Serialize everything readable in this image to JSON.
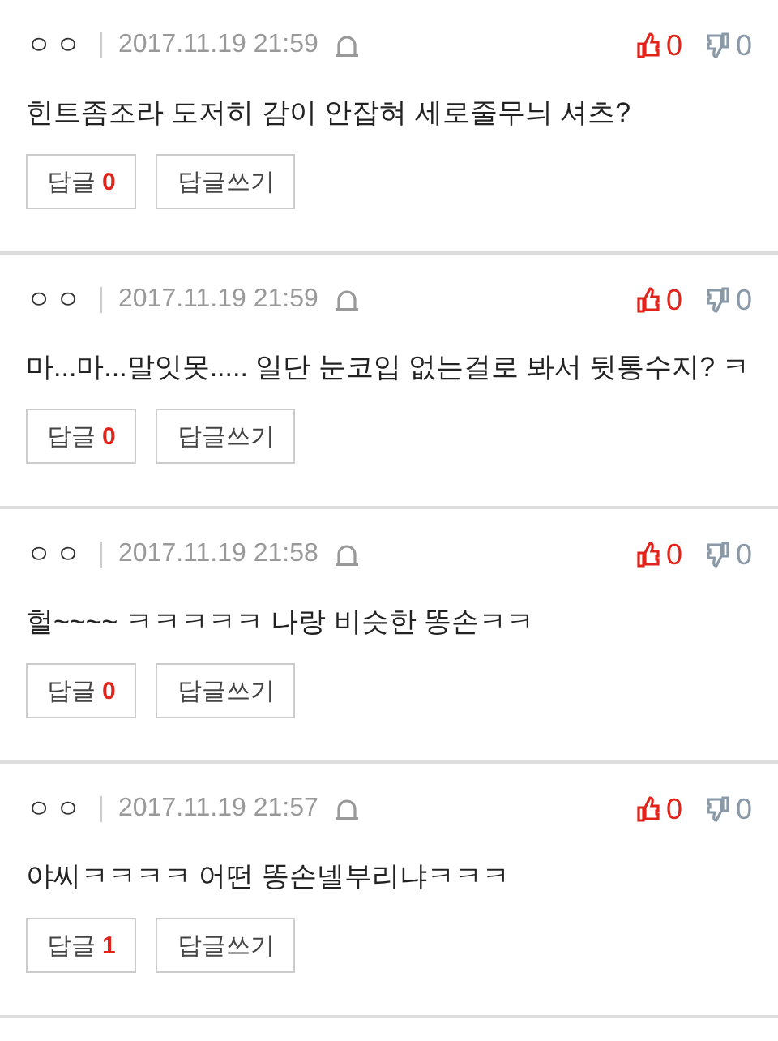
{
  "comments": [
    {
      "author": "ㅇㅇ",
      "date": "2017.11.19 21:59",
      "likes": "0",
      "dislikes": "0",
      "text": "힌트좀조라 도저히 감이 안잡혀 세로줄무늬 셔츠?",
      "reply_label": "답글",
      "reply_count": "0",
      "write_label": "답글쓰기"
    },
    {
      "author": "ㅇㅇ",
      "date": "2017.11.19 21:59",
      "likes": "0",
      "dislikes": "0",
      "text": "마...마...말잇못..... 일단 눈코입 없는걸로 봐서 뒷통수지? ㅋ",
      "reply_label": "답글",
      "reply_count": "0",
      "write_label": "답글쓰기"
    },
    {
      "author": "ㅇㅇ",
      "date": "2017.11.19 21:58",
      "likes": "0",
      "dislikes": "0",
      "text": "헐~~~~ ㅋㅋㅋㅋㅋ 나랑 비슷한 똥손ㅋㅋ",
      "reply_label": "답글",
      "reply_count": "0",
      "write_label": "답글쓰기"
    },
    {
      "author": "ㅇㅇ",
      "date": "2017.11.19 21:57",
      "likes": "0",
      "dislikes": "0",
      "text": "야씨ㅋㅋㅋㅋ 어떤 똥손넬부리냐ㅋㅋㅋ",
      "reply_label": "답글",
      "reply_count": "1",
      "write_label": "답글쓰기"
    }
  ]
}
